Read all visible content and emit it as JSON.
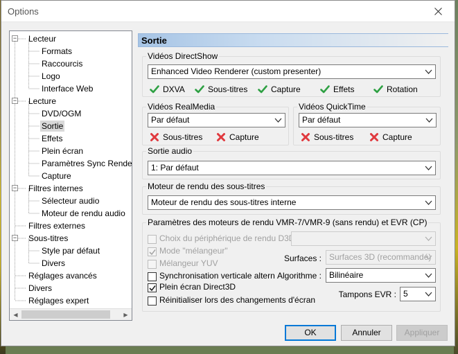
{
  "window": {
    "title": "Options"
  },
  "tree": {
    "items": [
      {
        "label": "Lecteur",
        "level": 0,
        "expander": "minus"
      },
      {
        "label": "Formats",
        "level": 1
      },
      {
        "label": "Raccourcis",
        "level": 1
      },
      {
        "label": "Logo",
        "level": 1
      },
      {
        "label": "Interface Web",
        "level": 1
      },
      {
        "label": "Lecture",
        "level": 0,
        "expander": "minus"
      },
      {
        "label": "DVD/OGM",
        "level": 1
      },
      {
        "label": "Sortie",
        "level": 1,
        "selected": true
      },
      {
        "label": "Effets",
        "level": 1
      },
      {
        "label": "Plein écran",
        "level": 1
      },
      {
        "label": "Paramètres Sync Rende",
        "level": 1
      },
      {
        "label": "Capture",
        "level": 1
      },
      {
        "label": "Filtres internes",
        "level": 0,
        "expander": "minus"
      },
      {
        "label": "Sélecteur audio",
        "level": 1
      },
      {
        "label": "Moteur de rendu audio",
        "level": 1
      },
      {
        "label": "Filtres externes",
        "level": 0
      },
      {
        "label": "Sous-titres",
        "level": 0,
        "expander": "minus"
      },
      {
        "label": "Style par défaut",
        "level": 1
      },
      {
        "label": "Divers",
        "level": 1
      },
      {
        "label": "Réglages avancés",
        "level": 0
      },
      {
        "label": "Divers",
        "level": 0
      },
      {
        "label": "Réglages expert",
        "level": 0
      }
    ]
  },
  "panel": {
    "title": "Sortie",
    "directshow": {
      "legend": "Vidéos DirectShow",
      "renderer": "Enhanced Video Renderer (custom presenter)",
      "features": [
        "DXVA",
        "Sous-titres",
        "Capture",
        "Effets",
        "Rotation"
      ]
    },
    "realmedia": {
      "legend": "Vidéos RealMedia",
      "value": "Par défaut",
      "features": [
        "Sous-titres",
        "Capture"
      ]
    },
    "quicktime": {
      "legend": "Vidéos QuickTime",
      "value": "Par défaut",
      "features": [
        "Sous-titres",
        "Capture"
      ]
    },
    "audio": {
      "legend": "Sortie audio",
      "value": "1: Par défaut"
    },
    "subs": {
      "legend": "Moteur de rendu des sous-titres",
      "value": "Moteur de rendu des sous-titres interne"
    },
    "vmr": {
      "legend": "Paramètres des moteurs de rendu VMR-7/VMR-9 (sans rendu) et EVR (CP)",
      "d3d9_device": "Choix du périphérique de rendu D3D9",
      "mixer_mode": "Mode \"mélangeur\"",
      "yuv_mixer": "Mélangeur YUV",
      "vsync": "Synchronisation verticale altern",
      "fullscreen_d3d": "Plein écran Direct3D",
      "reinit": "Réinitialiser lors des changements d'écran",
      "surfaces_label": "Surfaces :",
      "surfaces_value": "Surfaces 3D (recommandé)",
      "algo_label": "Algorithme :",
      "algo_value": "Bilinéaire",
      "evr_label": "Tampons EVR :",
      "evr_value": "5"
    }
  },
  "buttons": {
    "ok": "OK",
    "cancel": "Annuler",
    "apply": "Appliquer"
  },
  "colors": {
    "check_green": "#2ea043",
    "cross_red": "#e0393e",
    "selection": "#d9d9d9",
    "accent": "#0078d7"
  }
}
